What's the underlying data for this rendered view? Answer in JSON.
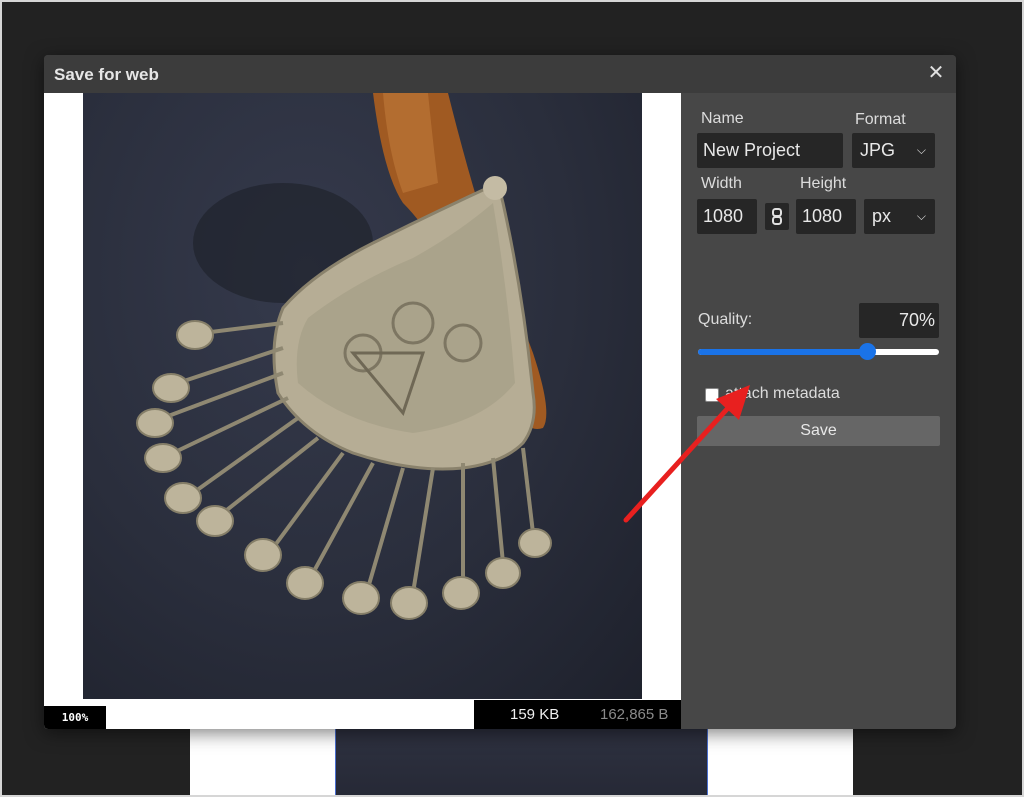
{
  "dialog": {
    "title": "Save for web",
    "close_icon": "close-icon"
  },
  "preview": {
    "zoom": "100%",
    "size_kb": "159 KB",
    "size_bytes": "162,865 B"
  },
  "panel": {
    "name_label": "Name",
    "name_value": "New Project",
    "format_label": "Format",
    "format_value": "JPG",
    "width_label": "Width",
    "width_value": "1080",
    "height_label": "Height",
    "height_value": "1080",
    "unit_value": "px",
    "link_icon": "link-icon",
    "quality_label": "Quality:",
    "quality_value": "70%",
    "quality_fraction": 0.7,
    "metadata_label": "attach metadata",
    "metadata_checked": false,
    "save_label": "Save"
  },
  "colors": {
    "accent": "#1a73e8",
    "annotation_arrow": "#e8201f"
  }
}
